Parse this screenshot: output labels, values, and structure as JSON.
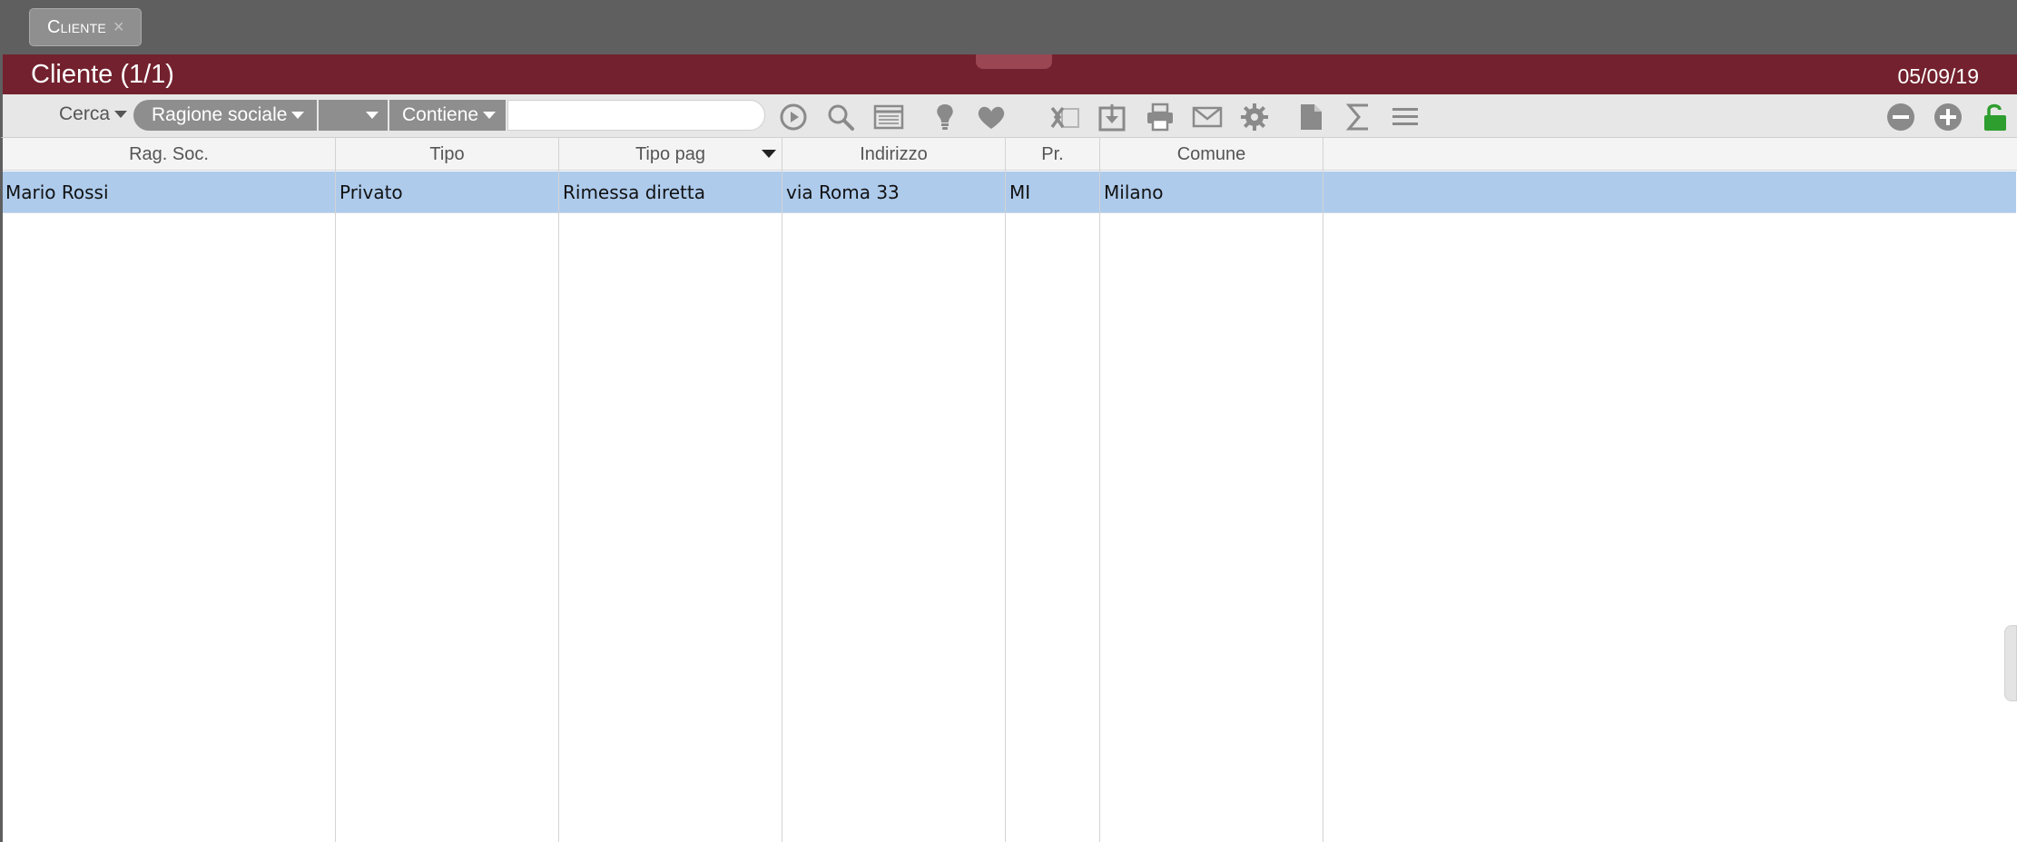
{
  "tab": {
    "label": "Cliente",
    "close": "×"
  },
  "titlebar": {
    "title": "Cliente (1/1)",
    "date": "05/09/19"
  },
  "toolbar": {
    "search_mode": "Cerca",
    "field_select": "Ragione sociale",
    "extra_select": "",
    "operator_select": "Contiene",
    "search_value": "",
    "icons": [
      "run-icon",
      "search-icon",
      "list-view-icon",
      "lightbulb-icon",
      "heart-icon",
      "excel-icon",
      "import-icon",
      "print-icon",
      "mail-icon",
      "gear-icon",
      "document-icon",
      "sum-icon",
      "menu-icon",
      "remove-icon",
      "add-icon",
      "lock-icon"
    ]
  },
  "grid": {
    "columns": [
      "Rag. Soc.",
      "Tipo",
      "Tipo pag",
      "Indirizzo",
      "Pr.",
      "Comune"
    ],
    "rows": [
      [
        "Mario Rossi",
        "Privato",
        "Rimessa diretta",
        "via Roma 33",
        "MI",
        "Milano"
      ]
    ]
  },
  "colors": {
    "accent": "#73212e",
    "selected_row": "#aecbec",
    "lock_green": "#2e9e2e"
  }
}
